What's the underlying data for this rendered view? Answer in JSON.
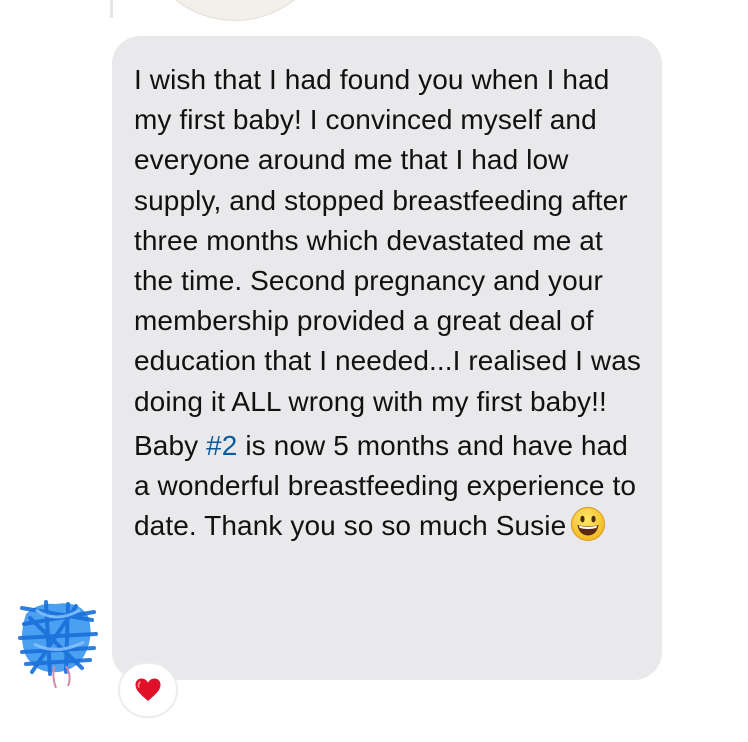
{
  "message": {
    "paragraph1": "I wish that I had found you when I had my first baby! I convinced myself and everyone around me that I had low supply, and stopped breastfeeding after three months which devastated me at the time. Second pregnancy and your membership provided a great deal of education that I needed...I realised I was doing it ALL wrong with my first baby!!",
    "paragraph2_before": "Baby ",
    "paragraph2_hashtag": "#2",
    "paragraph2_after": " is now 5 months and have had a wonderful breastfeeding experience to date. Thank you so so much Susie",
    "emoji_icon": "grinning-face-icon"
  },
  "reaction": {
    "icon": "red-heart-icon",
    "color": "#e0102a"
  },
  "colors": {
    "bubble": "#e9e9eb",
    "hashtag": "#0c5a9a",
    "avatar_scribble": "#2b8ff0"
  }
}
